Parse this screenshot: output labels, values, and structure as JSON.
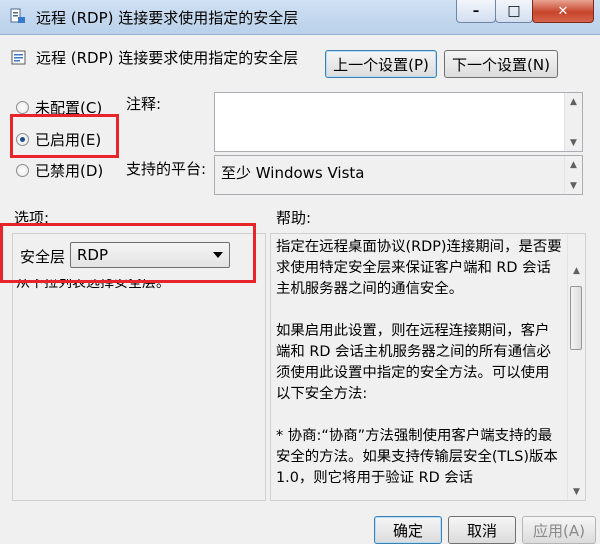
{
  "window": {
    "title": "远程 (RDP) 连接要求使用指定的安全层",
    "min_glyph": "–",
    "max_glyph": "□",
    "close_glyph": "✕"
  },
  "header": {
    "policy_title": "远程 (RDP) 连接要求使用指定的安全层",
    "prev_button": "上一个设置(P)",
    "next_button": "下一个设置(N)"
  },
  "state": {
    "not_configured": "未配置(C)",
    "enabled": "已启用(E)",
    "disabled": "已禁用(D)",
    "selected": "enabled"
  },
  "comment": {
    "label": "注释:",
    "value": ""
  },
  "platform": {
    "label": "支持的平台:",
    "value": "至少 Windows Vista"
  },
  "options": {
    "label": "选项:",
    "security_layer_label": "安全层",
    "security_layer_value": "RDP",
    "hint": "从下拉列表选择安全层。"
  },
  "help": {
    "label": "帮助:",
    "text": "指定在远程桌面协议(RDP)连接期间，是否要求使用特定安全层来保证客户端和 RD 会话主机服务器之间的通信安全。\n\n如果启用此设置，则在远程连接期间，客户端和 RD 会话主机服务器之间的所有通信必须使用此设置中指定的安全方法。可以使用以下安全方法:\n\n* 协商:“协商”方法强制使用客户端支持的最安全的方法。如果支持传输层安全(TLS)版本 1.0，则它将用于验证 RD 会话"
  },
  "footer": {
    "ok": "确定",
    "cancel": "取消",
    "apply": "应用(A)"
  },
  "colors": {
    "highlight": "#e8242b",
    "radio_selected": "#1b4f8a"
  }
}
